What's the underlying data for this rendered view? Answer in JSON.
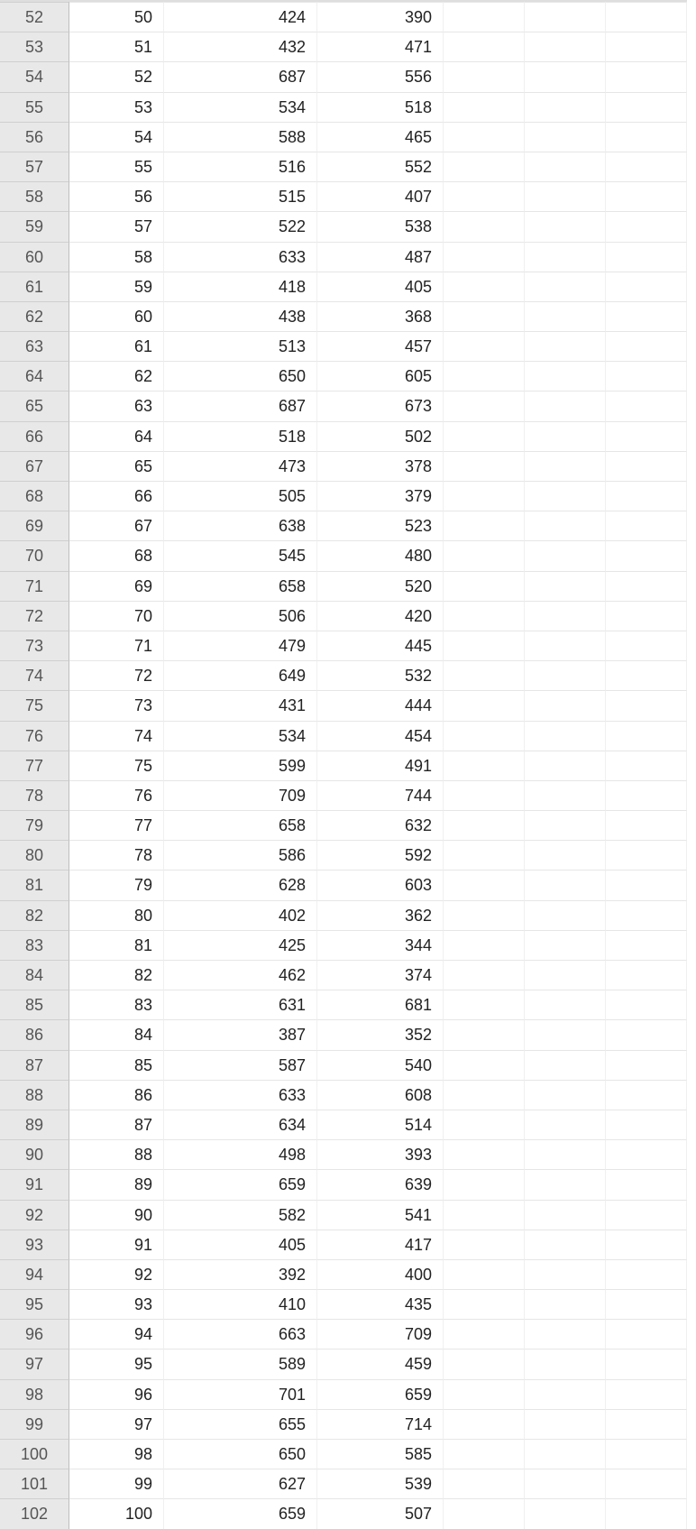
{
  "rows": [
    {
      "hdr": "52",
      "a": "50",
      "b": "424",
      "c": "390"
    },
    {
      "hdr": "53",
      "a": "51",
      "b": "432",
      "c": "471"
    },
    {
      "hdr": "54",
      "a": "52",
      "b": "687",
      "c": "556"
    },
    {
      "hdr": "55",
      "a": "53",
      "b": "534",
      "c": "518"
    },
    {
      "hdr": "56",
      "a": "54",
      "b": "588",
      "c": "465"
    },
    {
      "hdr": "57",
      "a": "55",
      "b": "516",
      "c": "552"
    },
    {
      "hdr": "58",
      "a": "56",
      "b": "515",
      "c": "407"
    },
    {
      "hdr": "59",
      "a": "57",
      "b": "522",
      "c": "538"
    },
    {
      "hdr": "60",
      "a": "58",
      "b": "633",
      "c": "487"
    },
    {
      "hdr": "61",
      "a": "59",
      "b": "418",
      "c": "405"
    },
    {
      "hdr": "62",
      "a": "60",
      "b": "438",
      "c": "368"
    },
    {
      "hdr": "63",
      "a": "61",
      "b": "513",
      "c": "457"
    },
    {
      "hdr": "64",
      "a": "62",
      "b": "650",
      "c": "605"
    },
    {
      "hdr": "65",
      "a": "63",
      "b": "687",
      "c": "673"
    },
    {
      "hdr": "66",
      "a": "64",
      "b": "518",
      "c": "502"
    },
    {
      "hdr": "67",
      "a": "65",
      "b": "473",
      "c": "378"
    },
    {
      "hdr": "68",
      "a": "66",
      "b": "505",
      "c": "379"
    },
    {
      "hdr": "69",
      "a": "67",
      "b": "638",
      "c": "523"
    },
    {
      "hdr": "70",
      "a": "68",
      "b": "545",
      "c": "480"
    },
    {
      "hdr": "71",
      "a": "69",
      "b": "658",
      "c": "520"
    },
    {
      "hdr": "72",
      "a": "70",
      "b": "506",
      "c": "420"
    },
    {
      "hdr": "73",
      "a": "71",
      "b": "479",
      "c": "445"
    },
    {
      "hdr": "74",
      "a": "72",
      "b": "649",
      "c": "532"
    },
    {
      "hdr": "75",
      "a": "73",
      "b": "431",
      "c": "444"
    },
    {
      "hdr": "76",
      "a": "74",
      "b": "534",
      "c": "454"
    },
    {
      "hdr": "77",
      "a": "75",
      "b": "599",
      "c": "491"
    },
    {
      "hdr": "78",
      "a": "76",
      "b": "709",
      "c": "744"
    },
    {
      "hdr": "79",
      "a": "77",
      "b": "658",
      "c": "632"
    },
    {
      "hdr": "80",
      "a": "78",
      "b": "586",
      "c": "592"
    },
    {
      "hdr": "81",
      "a": "79",
      "b": "628",
      "c": "603"
    },
    {
      "hdr": "82",
      "a": "80",
      "b": "402",
      "c": "362"
    },
    {
      "hdr": "83",
      "a": "81",
      "b": "425",
      "c": "344"
    },
    {
      "hdr": "84",
      "a": "82",
      "b": "462",
      "c": "374"
    },
    {
      "hdr": "85",
      "a": "83",
      "b": "631",
      "c": "681"
    },
    {
      "hdr": "86",
      "a": "84",
      "b": "387",
      "c": "352"
    },
    {
      "hdr": "87",
      "a": "85",
      "b": "587",
      "c": "540"
    },
    {
      "hdr": "88",
      "a": "86",
      "b": "633",
      "c": "608"
    },
    {
      "hdr": "89",
      "a": "87",
      "b": "634",
      "c": "514"
    },
    {
      "hdr": "90",
      "a": "88",
      "b": "498",
      "c": "393"
    },
    {
      "hdr": "91",
      "a": "89",
      "b": "659",
      "c": "639"
    },
    {
      "hdr": "92",
      "a": "90",
      "b": "582",
      "c": "541"
    },
    {
      "hdr": "93",
      "a": "91",
      "b": "405",
      "c": "417"
    },
    {
      "hdr": "94",
      "a": "92",
      "b": "392",
      "c": "400"
    },
    {
      "hdr": "95",
      "a": "93",
      "b": "410",
      "c": "435"
    },
    {
      "hdr": "96",
      "a": "94",
      "b": "663",
      "c": "709"
    },
    {
      "hdr": "97",
      "a": "95",
      "b": "589",
      "c": "459"
    },
    {
      "hdr": "98",
      "a": "96",
      "b": "701",
      "c": "659"
    },
    {
      "hdr": "99",
      "a": "97",
      "b": "655",
      "c": "714"
    },
    {
      "hdr": "100",
      "a": "98",
      "b": "650",
      "c": "585"
    },
    {
      "hdr": "101",
      "a": "99",
      "b": "627",
      "c": "539"
    },
    {
      "hdr": "102",
      "a": "100",
      "b": "659",
      "c": "507"
    }
  ]
}
